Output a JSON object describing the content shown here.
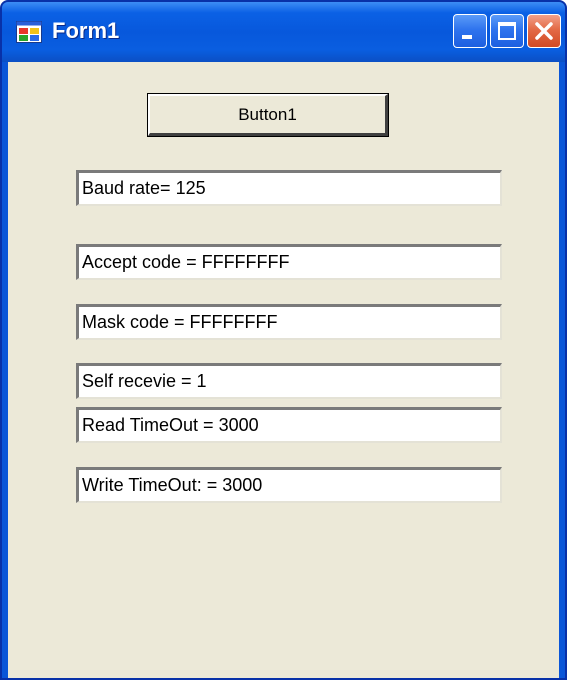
{
  "window": {
    "title": "Form1",
    "icon": "form-app-icon",
    "controls": [
      "minimize-icon",
      "maximize-icon",
      "close-icon"
    ]
  },
  "form": {
    "button_label": "Button1",
    "textboxes": [
      "Baud rate= 125",
      "Accept code = FFFFFFFF",
      "Mask code = FFFFFFFF",
      "Self recevie = 1",
      "Read TimeOut = 3000",
      "Write TimeOut: = 3000"
    ]
  },
  "colors": {
    "titlebar": "#0758dc",
    "client_background": "#ece9d8",
    "close_button": "#d24a24"
  }
}
